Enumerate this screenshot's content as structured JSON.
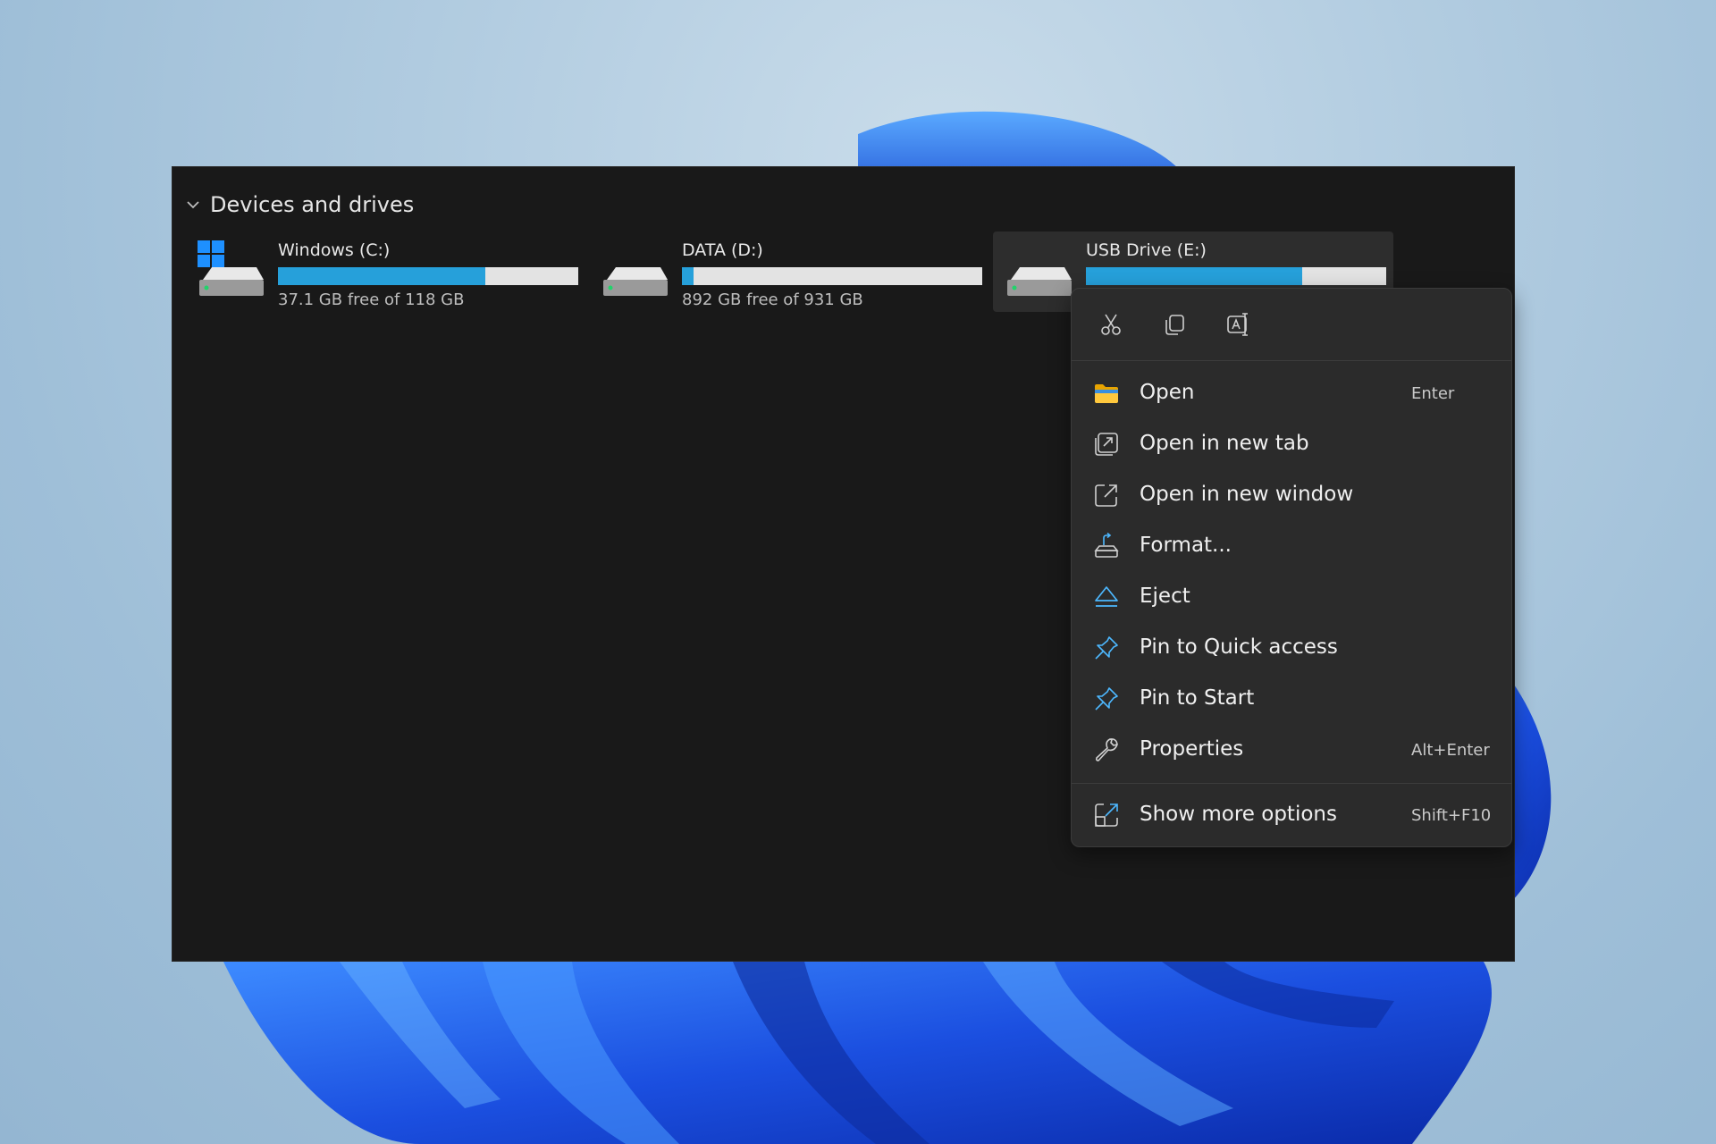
{
  "section": {
    "title": "Devices and drives"
  },
  "drives": [
    {
      "name": "Windows (C:)",
      "free_text": "37.1 GB free of 118 GB",
      "used_fraction": 0.69,
      "system": true
    },
    {
      "name": "DATA (D:)",
      "free_text": "892 GB free of 931 GB",
      "used_fraction": 0.04,
      "system": false
    },
    {
      "name": "USB Drive (E:)",
      "free_text": "",
      "used_fraction": 0.72,
      "system": false,
      "selected": true
    }
  ],
  "context_menu": {
    "quick_actions": [
      {
        "icon": "cut-icon"
      },
      {
        "icon": "copy-icon"
      },
      {
        "icon": "rename-icon"
      }
    ],
    "items": [
      {
        "label": "Open",
        "shortcut": "Enter",
        "icon": "folder-icon"
      },
      {
        "label": "Open in new tab",
        "shortcut": "",
        "icon": "new-tab-icon"
      },
      {
        "label": "Open in new window",
        "shortcut": "",
        "icon": "new-window-icon"
      },
      {
        "label": "Format...",
        "shortcut": "",
        "icon": "format-icon"
      },
      {
        "label": "Eject",
        "shortcut": "",
        "icon": "eject-icon"
      },
      {
        "label": "Pin to Quick access",
        "shortcut": "",
        "icon": "pin-icon"
      },
      {
        "label": "Pin to Start",
        "shortcut": "",
        "icon": "pin-icon"
      },
      {
        "label": "Properties",
        "shortcut": "Alt+Enter",
        "icon": "wrench-icon"
      },
      {
        "label": "Show more options",
        "shortcut": "Shift+F10",
        "icon": "more-options-icon"
      }
    ]
  },
  "colors": {
    "accent": "#26a0da",
    "window_bg": "#191919",
    "menu_bg": "#2b2b2b",
    "wallpaper_blue": "#1b4fe0"
  }
}
